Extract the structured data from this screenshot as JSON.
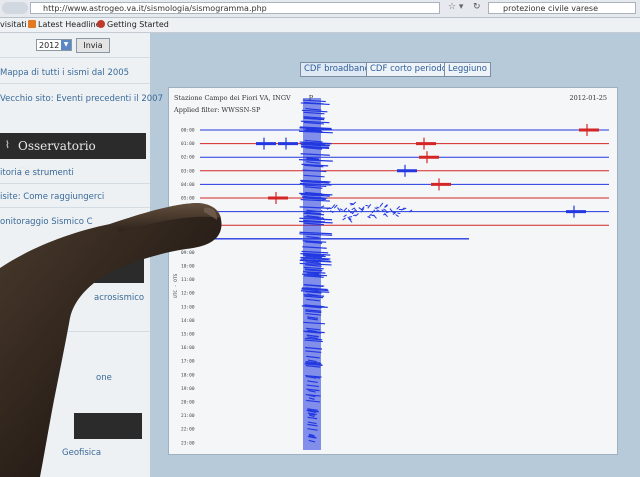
{
  "browser": {
    "url": "http://www.astrogeo.va.it/sismologia/sismogramma.php",
    "search_value": "protezione civile varese",
    "bookmarks": [
      "visitati",
      "Latest Headlines",
      "Getting Started"
    ]
  },
  "sidebar": {
    "year_value": "2012",
    "submit_label": "Invia",
    "links": [
      "Mappa di tutti i sismi dal 2005",
      "Vecchio sito: Eventi precedenti il 2007"
    ],
    "section_title": "Osservatorio Sismico",
    "section_links": [
      "itoria e strumenti",
      "isite: Come raggiungerci",
      "onitoraggio Sismico C"
    ],
    "partial_labels": [
      "acrosismico",
      "one",
      "Geofisica"
    ]
  },
  "tabs": [
    "CDF broadband",
    "CDF corto periodo",
    "Leggiuno"
  ],
  "seismogram": {
    "station": "Stazione Campo dei Fiori VA, INGV",
    "station_tail": "P",
    "filter": "Applied filter: WWSSN-SP",
    "date": "2012-01-25",
    "side_axis_label": "UTC - OTS",
    "time_labels": [
      "00:00",
      "01:00",
      "02:00",
      "03:00",
      "04:00",
      "05:00",
      "06:00",
      "07:00",
      "08:00",
      "09:00",
      "10:00",
      "11:00",
      "12:00",
      "13:00",
      "14:00",
      "15:00",
      "16:00",
      "17:00",
      "18:00",
      "19:00",
      "20:00",
      "21:00",
      "22:00",
      "23:00"
    ]
  },
  "colors": {
    "trace_blue": "#2338e0",
    "trace_red": "#d42626",
    "panel_bg": "#f4f6f7",
    "sidebar_link": "#3a6a98"
  }
}
